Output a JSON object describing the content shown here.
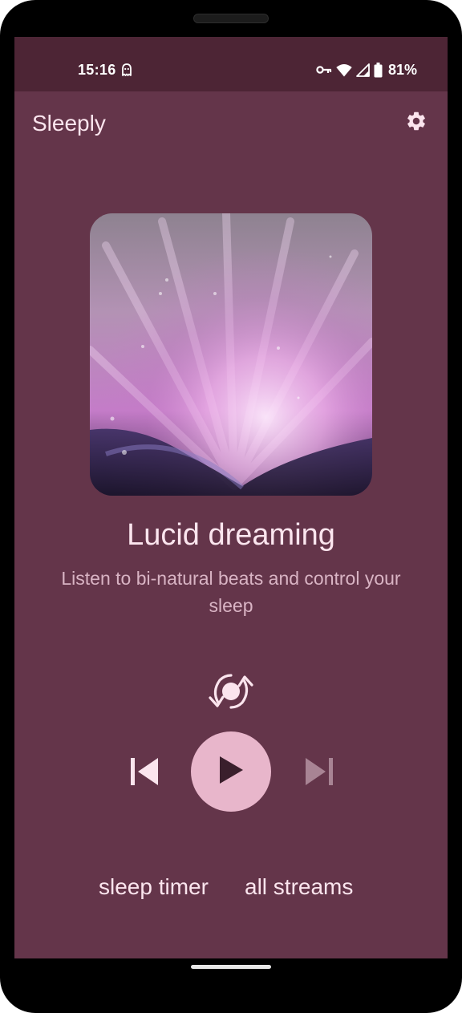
{
  "status_bar": {
    "time": "15:16",
    "battery_percent": "81%",
    "icons": [
      "ghost-icon",
      "vpn-key-icon",
      "wifi-icon",
      "cell-signal-icon",
      "battery-icon"
    ]
  },
  "app_bar": {
    "title": "Sleeply",
    "settings_icon": "gear-icon"
  },
  "track": {
    "title": "Lucid dreaming",
    "subtitle": "Listen to bi-natural beats and control your sleep"
  },
  "controls": {
    "repeat_icon": "repeat-sync-icon",
    "previous_icon": "skip-previous-icon",
    "play_icon": "play-icon",
    "next_icon": "skip-next-icon",
    "next_enabled": false
  },
  "links": {
    "sleep_timer": "sleep timer",
    "all_streams": "all streams"
  },
  "colors": {
    "background": "#64354a",
    "status_bar": "#4d2535",
    "accent": "#e8b6cb",
    "text_primary": "#fbe5ee",
    "text_secondary": "#d9b4c4"
  }
}
